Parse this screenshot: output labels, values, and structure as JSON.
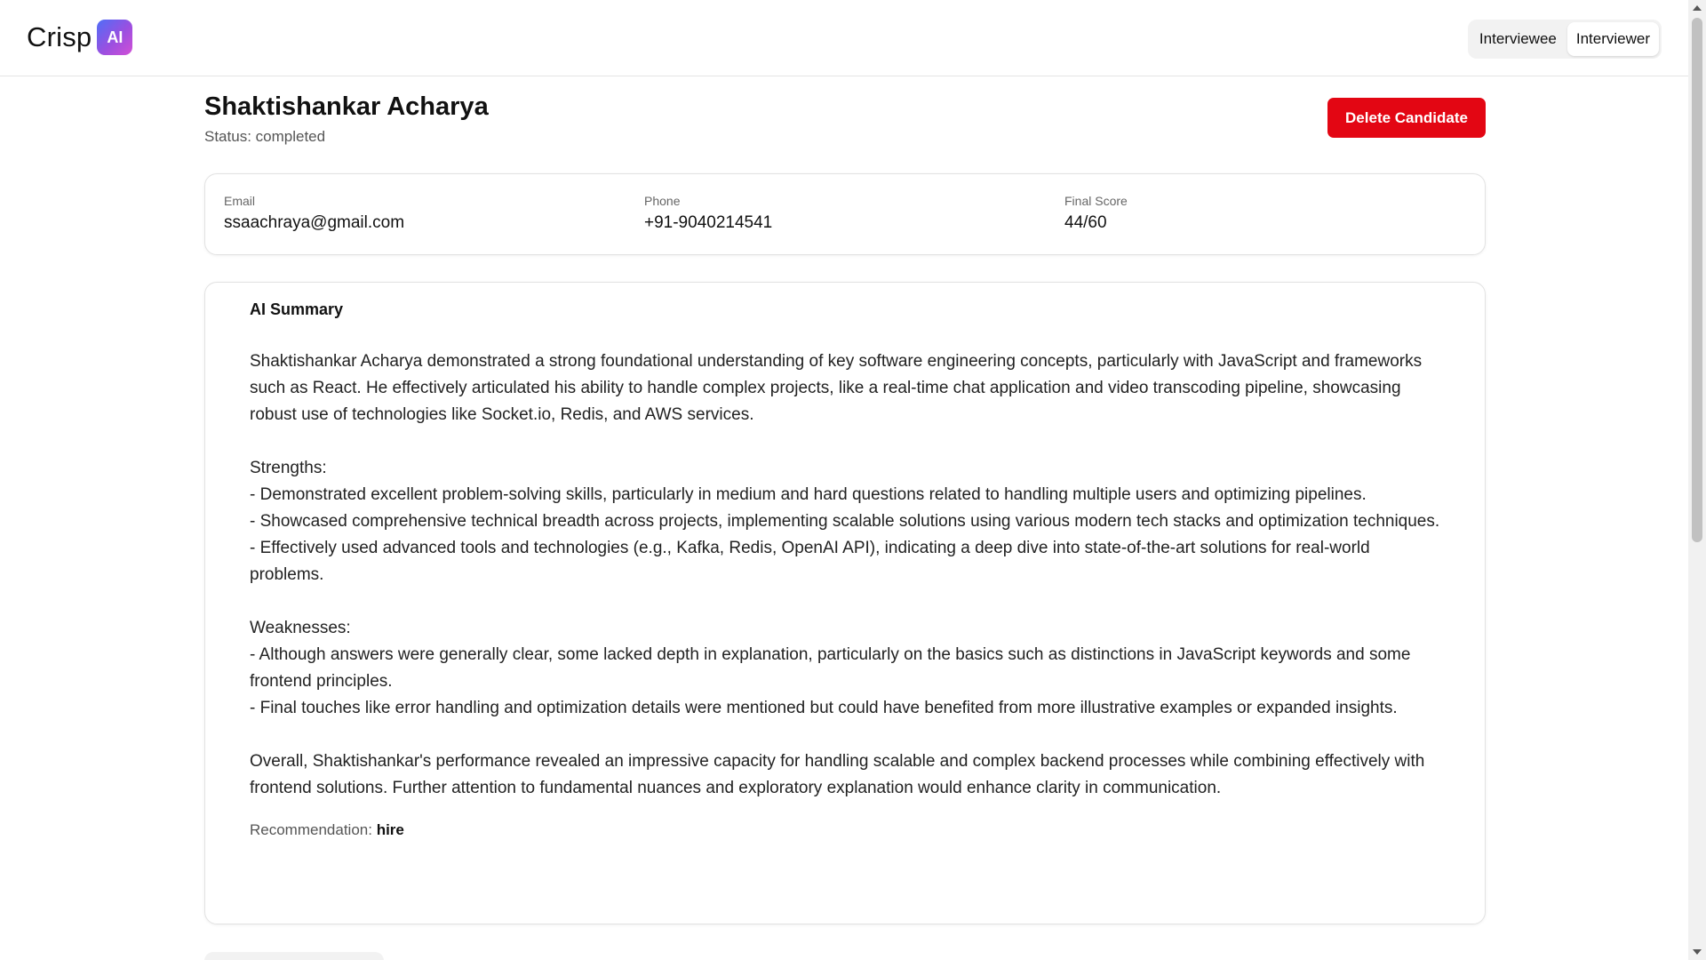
{
  "app": {
    "logo_text": "Crisp",
    "logo_badge": "AI"
  },
  "role_toggle": {
    "options": [
      "Interviewee",
      "Interviewer"
    ],
    "active": "Interviewer"
  },
  "candidate": {
    "name": "Shaktishankar Acharya",
    "status": "Status: completed",
    "delete_label": "Delete Candidate",
    "email_label": "Email",
    "email": "ssaachraya@gmail.com",
    "phone_label": "Phone",
    "phone": "+91-9040214541",
    "score_label": "Final Score",
    "score": "44/60"
  },
  "summary": {
    "title": "AI Summary",
    "text": "Shaktishankar Acharya demonstrated a strong foundational understanding of key software engineering concepts, particularly with JavaScript and frameworks such as React. He effectively articulated his ability to handle complex projects, like a real-time chat application and video transcoding pipeline, showcasing robust use of technologies like Socket.io, Redis, and AWS services.\n\nStrengths:\n- Demonstrated excellent problem-solving skills, particularly in medium and hard questions related to handling multiple users and optimizing pipelines.\n- Showcased comprehensive technical breadth across projects, implementing scalable solutions using various modern tech stacks and optimization techniques.\n- Effectively used advanced tools and technologies (e.g., Kafka, Redis, OpenAI API), indicating a deep dive into state-of-the-art solutions for real-world problems.\n\nWeaknesses:\n- Although answers were generally clear, some lacked depth in explanation, particularly on the basics such as distinctions in JavaScript keywords and some frontend principles.\n- Final touches like error handling and optimization details were mentioned but could have benefited from more illustrative examples or expanded insights.\n\nOverall, Shaktishankar's performance revealed an impressive capacity for handling scalable and complex backend processes while combining effectively with frontend solutions. Further attention to fundamental nuances and exploratory explanation would enhance clarity in communication.",
    "recommendation_label": "Recommendation:",
    "recommendation_value": "hire"
  }
}
